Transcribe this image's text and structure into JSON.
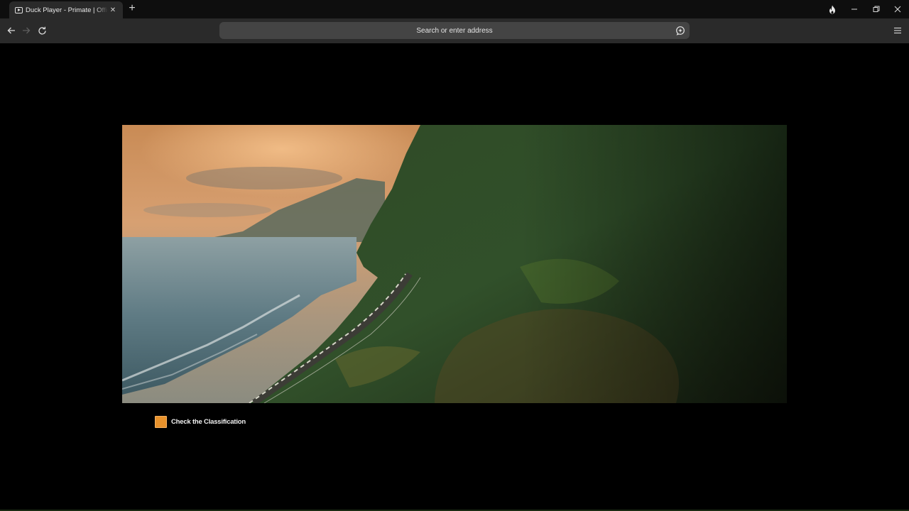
{
  "browser": {
    "tab": {
      "icon": "video-player-icon",
      "title": "Duck Player - Primate | Official Trailer",
      "close_icon": "close-icon"
    },
    "new_tab_icon": "plus-icon",
    "window_controls": [
      "fire-icon",
      "minimize-icon",
      "restore-icon",
      "close-icon"
    ],
    "nav": [
      "back-arrow-icon",
      "forward-arrow-icon",
      "reload-icon"
    ],
    "address_bar": {
      "placeholder": "Search or enter address",
      "value": "",
      "duck_icon": "duck-ai-icon"
    },
    "menu_icon": "hamburger-menu-icon"
  },
  "player": {
    "scene": "coastal cliff road at sunset",
    "checkbox_color": "#e8922c",
    "classification_label": "Check the Classification"
  }
}
